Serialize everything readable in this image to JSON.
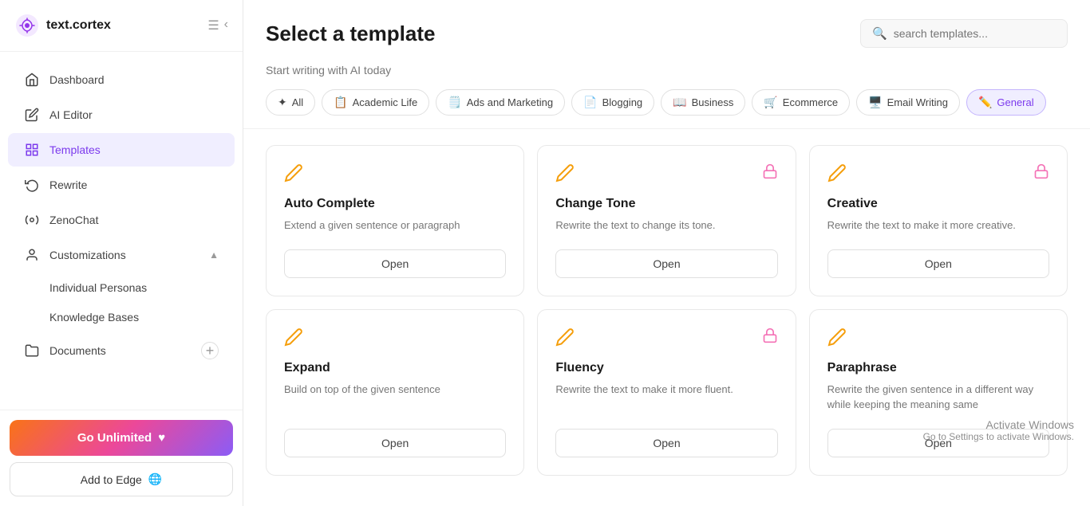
{
  "app": {
    "name": "text.cortex"
  },
  "sidebar": {
    "nav_items": [
      {
        "id": "dashboard",
        "label": "Dashboard",
        "icon": "🏠",
        "active": false
      },
      {
        "id": "ai-editor",
        "label": "AI Editor",
        "icon": "✏️",
        "active": false
      },
      {
        "id": "templates",
        "label": "Templates",
        "icon": "≡",
        "active": true
      },
      {
        "id": "rewrite",
        "label": "Rewrite",
        "icon": "↺",
        "active": false
      },
      {
        "id": "zenochat",
        "label": "ZenoChat",
        "icon": "⚙️",
        "active": false
      },
      {
        "id": "customizations",
        "label": "Customizations",
        "icon": "👤",
        "active": false,
        "has_arrow": true
      }
    ],
    "sub_nav": [
      {
        "id": "individual-personas",
        "label": "Individual Personas"
      },
      {
        "id": "knowledge-bases",
        "label": "Knowledge Bases"
      }
    ],
    "documents": {
      "label": "Documents",
      "icon": "📁",
      "add_icon": "+"
    },
    "go_unlimited": {
      "label": "Go Unlimited",
      "icon": "♥"
    },
    "add_to_edge": {
      "label": "Add to Edge",
      "icon": "🌐"
    }
  },
  "main": {
    "title": "Select a template",
    "subtitle": "Start writing with AI today",
    "search_placeholder": "search templates...",
    "filter_tabs": [
      {
        "id": "all",
        "label": "All",
        "icon": "✦",
        "active": false
      },
      {
        "id": "academic-life",
        "label": "Academic Life",
        "icon": "📋",
        "active": false
      },
      {
        "id": "ads-marketing",
        "label": "Ads and Marketing",
        "icon": "🗒️",
        "active": false
      },
      {
        "id": "blogging",
        "label": "Blogging",
        "icon": "📄",
        "active": false
      },
      {
        "id": "business",
        "label": "Business",
        "icon": "📖",
        "active": false
      },
      {
        "id": "ecommerce",
        "label": "Ecommerce",
        "icon": "🛒",
        "active": false
      },
      {
        "id": "email-writing",
        "label": "Email Writing",
        "icon": "🖥️",
        "active": false
      },
      {
        "id": "general",
        "label": "General",
        "icon": "✏️",
        "active": true
      }
    ],
    "template_cards": [
      {
        "id": "auto-complete",
        "title": "Auto Complete",
        "description": "Extend a given sentence or paragraph",
        "has_lock": false,
        "open_label": "Open"
      },
      {
        "id": "change-tone",
        "title": "Change Tone",
        "description": "Rewrite the text to change its tone.",
        "has_lock": true,
        "open_label": "Open"
      },
      {
        "id": "creative",
        "title": "Creative",
        "description": "Rewrite the text to make it more creative.",
        "has_lock": true,
        "open_label": "Open"
      },
      {
        "id": "expand",
        "title": "Expand",
        "description": "Build on top of the given sentence",
        "has_lock": false,
        "open_label": "Open"
      },
      {
        "id": "fluency",
        "title": "Fluency",
        "description": "Rewrite the text to make it more fluent.",
        "has_lock": true,
        "open_label": "Open"
      },
      {
        "id": "paraphrase",
        "title": "Paraphrase",
        "description": "Rewrite the given sentence in a different way while keeping the meaning same",
        "has_lock": false,
        "open_label": "Open"
      }
    ]
  },
  "watermark": {
    "title": "Activate Windows",
    "subtitle": "Go to Settings to activate Windows."
  }
}
